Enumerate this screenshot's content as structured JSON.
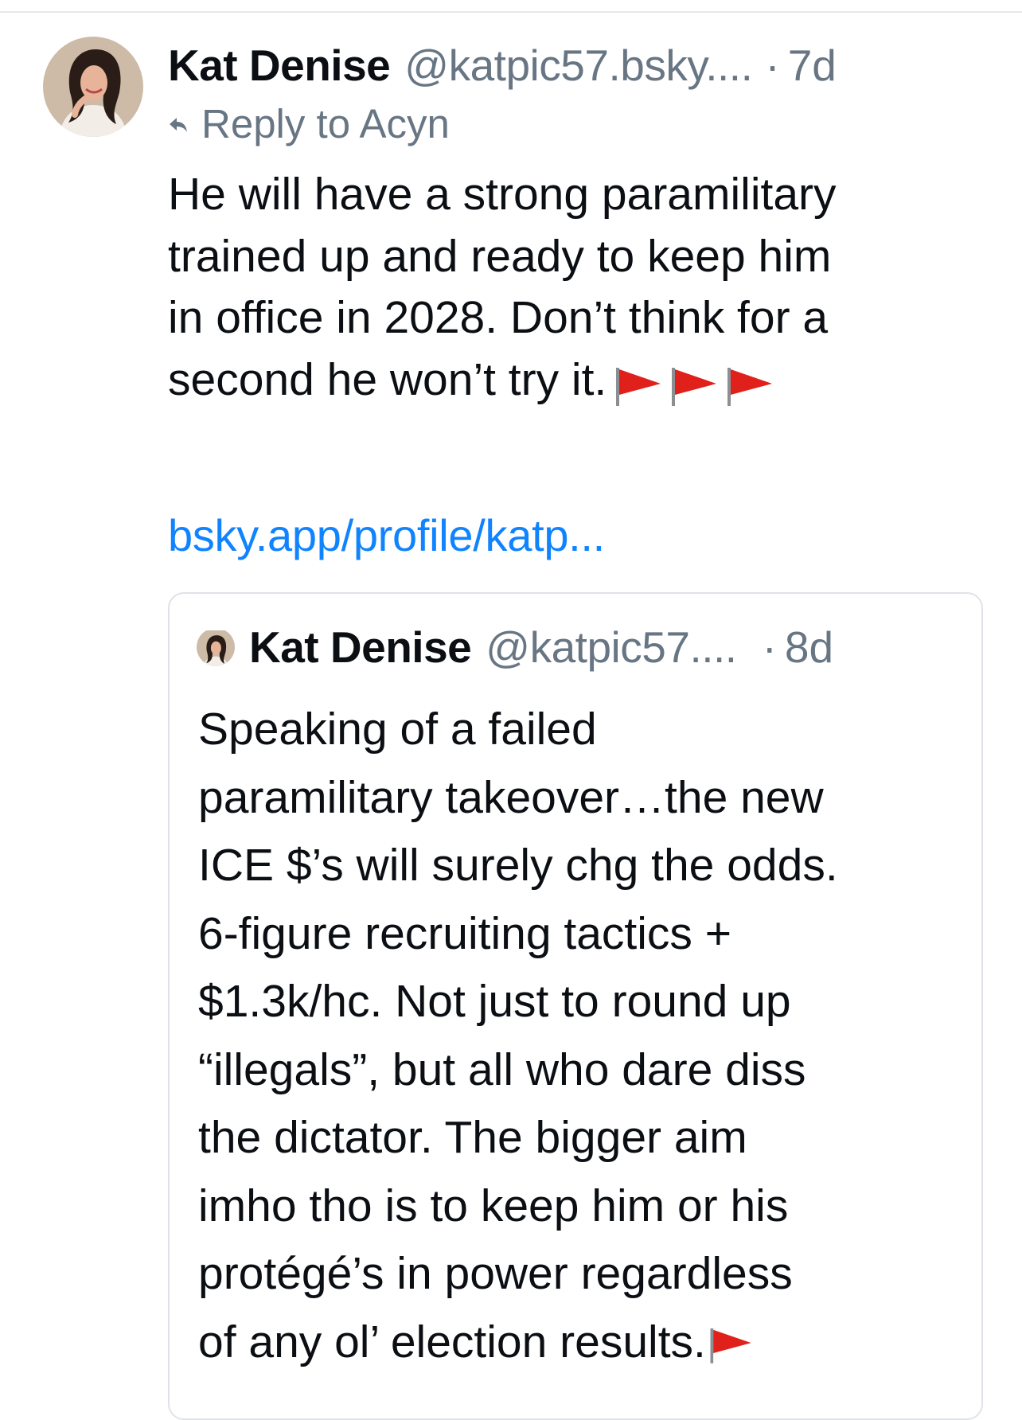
{
  "post": {
    "display_name": "Kat Denise",
    "handle": "@katpic57.bsky....",
    "separator": "·",
    "time": "7d",
    "reply_to": "Reply to Acyn",
    "text_lines": [
      "He will have a strong paramilitary",
      "trained up and ready to keep him",
      "in office in 2028. Don’t think for a",
      "second he won’t try it."
    ],
    "emoji": [
      "red-flag",
      "red-flag",
      "red-flag"
    ],
    "link": "bsky.app/profile/katp..."
  },
  "quote": {
    "display_name": "Kat Denise",
    "handle": "@katpic57....",
    "separator": "·",
    "time": "8d",
    "text_lines": [
      "Speaking of a failed",
      "paramilitary takeover…the new",
      "ICE $’s will surely chg the odds.",
      "6-figure recruiting tactics +",
      "$1.3k/hc. Not just to round up",
      "“illegals”, but all who dare diss",
      "the dictator. The bigger aim",
      "imho tho is to keep him or his",
      "protégé’s in power regardless",
      "of any ol’ election results."
    ],
    "emoji": [
      "red-flag"
    ]
  },
  "colors": {
    "text": "#0b0f14",
    "muted": "#687684",
    "link": "#1083fe",
    "border": "#dfe3e8",
    "flag": "#e0201b"
  }
}
